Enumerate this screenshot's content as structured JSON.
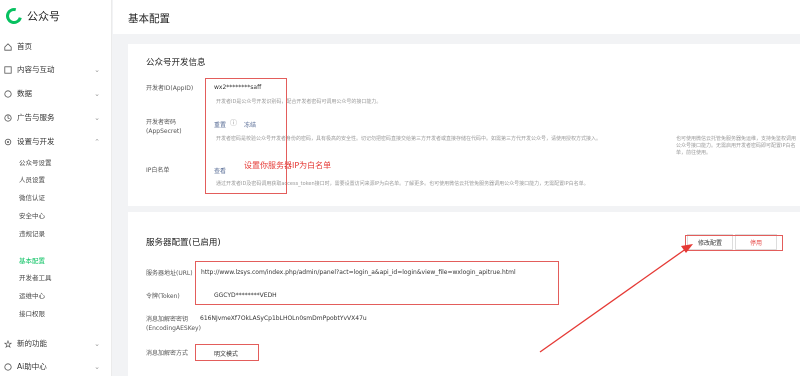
{
  "app": {
    "name": "公众号"
  },
  "sidebar": {
    "items": [
      {
        "label": "首页"
      },
      {
        "label": "内容与互动"
      },
      {
        "label": "数据"
      },
      {
        "label": "广告与服务"
      },
      {
        "label": "设置与开发"
      },
      {
        "label": "新的功能"
      },
      {
        "label": "Ai助中心"
      }
    ],
    "sub_items": [
      {
        "label": "公众号设置"
      },
      {
        "label": "人员设置"
      },
      {
        "label": "微信认证"
      },
      {
        "label": "安全中心"
      },
      {
        "label": "违规记录"
      },
      {
        "label": "基本配置"
      },
      {
        "label": "开发者工具"
      },
      {
        "label": "运维中心"
      },
      {
        "label": "接口权限"
      }
    ]
  },
  "header": {
    "title": "基本配置"
  },
  "dev_info": {
    "title": "公众号开发信息",
    "appid_label": "开发者ID(AppID)",
    "appid_value": "wx2********saff",
    "appid_desc": "开发者ID是公众号开发识别码，配合开发者密码可调用公众号的接口能力。",
    "secret_label": "开发者密码(AppSecret)",
    "secret_reset": "重置",
    "secret_freeze": "冻结",
    "secret_desc1": "开发者密码是校验公众号开发者身份的密码，具有极高的安全性。切记勿把密码直接交给第三方开发者或直接存储在代码中。如需第三方代开发公众号，请使用授权方式接入。",
    "secret_desc2": "也可使用微信云托管免服务器免运维，支持免鉴权调用公众号接口能力。无需启用开发者密码即可配置IP白名单，前往使用。",
    "whitelist_label": "IP白名单",
    "whitelist_view": "查看",
    "whitelist_desc": "通过开发者ID及密码调用获取access_token接口时，需要设置访问来源IP为白名单。了解更多。也可使用微信云托管免服务器调用公众号接口能力，无需配置IP白名单。",
    "annotation": "设置你服务器IP为白名单"
  },
  "server": {
    "title": "服务器配置(已启用)",
    "edit_button": "修改配置",
    "disable_button": "停用",
    "url_label": "服务器地址(URL)",
    "url_value": "http://www.lzsys.com/index.php/admin/panel?act=login_a&api_id=login&view_file=wxlogin_apitrue.html",
    "token_label": "令牌(Token)",
    "token_value": "GGCYD********VEDH",
    "aes_label": "消息加解密密钥(EncodingAESKey)",
    "aes_value": "616NJvmeXf7OkLASyCp1bLHOLn0smDmPpobtYvVX47u",
    "mode_label": "消息加解密方式",
    "mode_value": "明文模式"
  },
  "colors": {
    "brand": "#07c160",
    "annotation": "#e35d5b",
    "link": "#576b95"
  },
  "icons": [
    "home-icon",
    "content-icon",
    "data-icon",
    "ad-icon",
    "settings-icon",
    "feature-icon",
    "help-icon"
  ]
}
